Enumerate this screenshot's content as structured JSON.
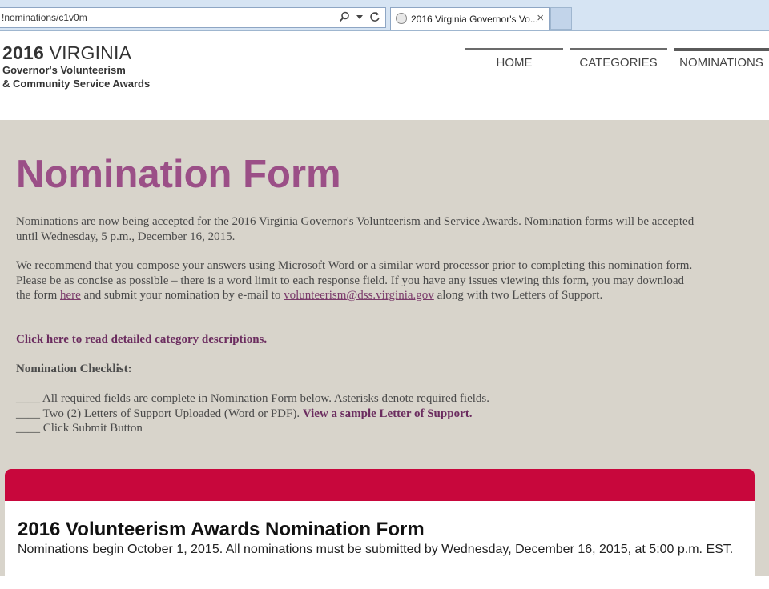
{
  "browser": {
    "address_text": "!nominations/c1v0m",
    "tab_title": "2016 Virginia Governor's Vo...",
    "tab_close": "×",
    "icons": [
      "search-icon",
      "dropdown-icon",
      "refresh-icon"
    ]
  },
  "header": {
    "brand_year": "2016",
    "brand_state": "VIRGINIA",
    "brand_line2": "Governor's Volunteerism",
    "brand_line3": "& Community Service Awards"
  },
  "nav": {
    "items": [
      {
        "label": "HOME"
      },
      {
        "label": "CATEGORIES"
      },
      {
        "label": "NOMINATIONS"
      }
    ],
    "active": "NOMINATIONS"
  },
  "main": {
    "title": "Nomination Form",
    "intro": "Nominations are now being accepted for the 2016 Virginia Governor's Volunteerism and Service Awards. Nomination forms will be accepted until Wednesday, 5 p.m., December 16, 2015.",
    "recommend_part1": "We recommend that you compose your answers using Microsoft Word or a similar word processor prior to completing this nomination form. Please be as concise as possible – there is a word limit to each response field. If you have any issues viewing this form, you may download the form ",
    "here_link": "here",
    "recommend_part2": " and submit your nomination by e-mail to ",
    "email_link": "volunteerism@dss.virginia.gov",
    "recommend_part3": " along with two Letters of Support.",
    "category_link": "Click here to read detailed category descriptions.",
    "checklist_heading": "Nomination Checklist:",
    "checklist": {
      "item1": "____ All required fields are complete in Nomination Form below. Asterisks denote required fields.",
      "item2": "____ Two (2) Letters of Support Uploaded (Word or PDF). ",
      "item2_link": "View a sample Letter of Support.",
      "item3": "____ Click Submit Button"
    }
  },
  "form": {
    "title": "2016 Volunteerism Awards Nomination Form",
    "subtitle": "Nominations begin October 1, 2015. All nominations must be submitted by Wednesday, December 16, 2015, at 5:00 p.m. EST."
  },
  "colors": {
    "title_purple": "#9b4f87",
    "link_purple": "#6b2c5f",
    "main_bg": "#d8d4cb",
    "form_bar": "#c8073c"
  }
}
